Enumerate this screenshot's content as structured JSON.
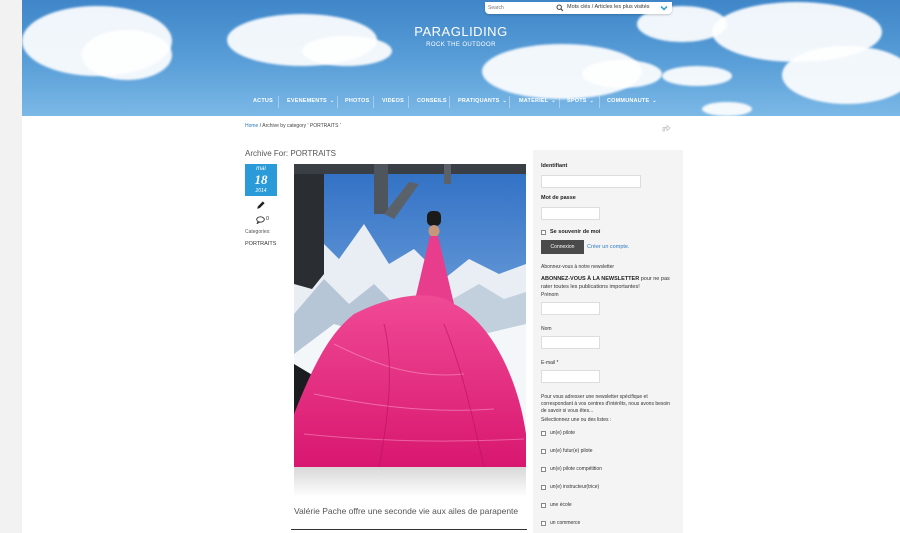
{
  "site": {
    "title": "PARAGLIDING",
    "tagline": "ROCK THE OUTDOOR"
  },
  "topbar": {
    "search_placeholder": "Search",
    "tags_link": "Mots clés / Articles les plus visités"
  },
  "nav": [
    {
      "label": "ACTUS",
      "has_dropdown": false
    },
    {
      "label": "EVENEMENTS",
      "has_dropdown": true
    },
    {
      "label": "PHOTOS",
      "has_dropdown": false
    },
    {
      "label": "VIDEOS",
      "has_dropdown": false
    },
    {
      "label": "CONSEILS",
      "has_dropdown": false
    },
    {
      "label": "PRATIQUANTS",
      "has_dropdown": true
    },
    {
      "label": "MATERIEL",
      "has_dropdown": true
    },
    {
      "label": "SPOTS",
      "has_dropdown": true
    },
    {
      "label": "COMMUNAUTE",
      "has_dropdown": true
    }
  ],
  "breadcrumb": {
    "home": "Home",
    "rest": " / Archive by category ' PORTRAITS '"
  },
  "archive": {
    "title": "Archive For: PORTRAITS"
  },
  "post": {
    "month": "mai",
    "day": "18",
    "year": "2014",
    "comments": "0",
    "categories_label": "Categories:",
    "category": "PORTRAITS",
    "title": "Valérie Pache offre une seconde vie aux ailes de parapente"
  },
  "sidebar": {
    "identifiant_label": "Identifiant",
    "identifiant_value": "",
    "password_label": "Mot de passe",
    "password_value": "",
    "remember_label": "Se souvenir de moi",
    "login_button": "Connexion",
    "create_account": "Créer un compte.",
    "newsletter_heading": "Abonnez-vous à notre newsletter",
    "newsletter_bold": "ABONNEZ-VOUS À LA NEWSLETTER",
    "newsletter_rest": " pour ne pas rater toutes les publications importantes!",
    "prenom_label": "Prénom",
    "prenom_value": "",
    "nom_label": "Nom",
    "nom_value": "",
    "email_label": "E-mail *",
    "email_value": "",
    "lists_desc": "Pour vous adresser une newsletter spécifique et correspondant à vos centres d'intérêts, nous avons besoin de savoir si vous êtes...",
    "lists_prompt": "Sélectionnez une ou des listes :",
    "lists": [
      "un(e) pilote",
      "un(e) futur(e) pilote",
      "un(e) pilote compétition",
      "un(e) instructeur(trice)",
      "une école",
      "un commerce"
    ]
  },
  "colors": {
    "header_sky": "#4a90d0",
    "accent_blue": "#2a9ad9",
    "wing_pink": "#e8247a",
    "button_dark": "#4a4a4a"
  }
}
